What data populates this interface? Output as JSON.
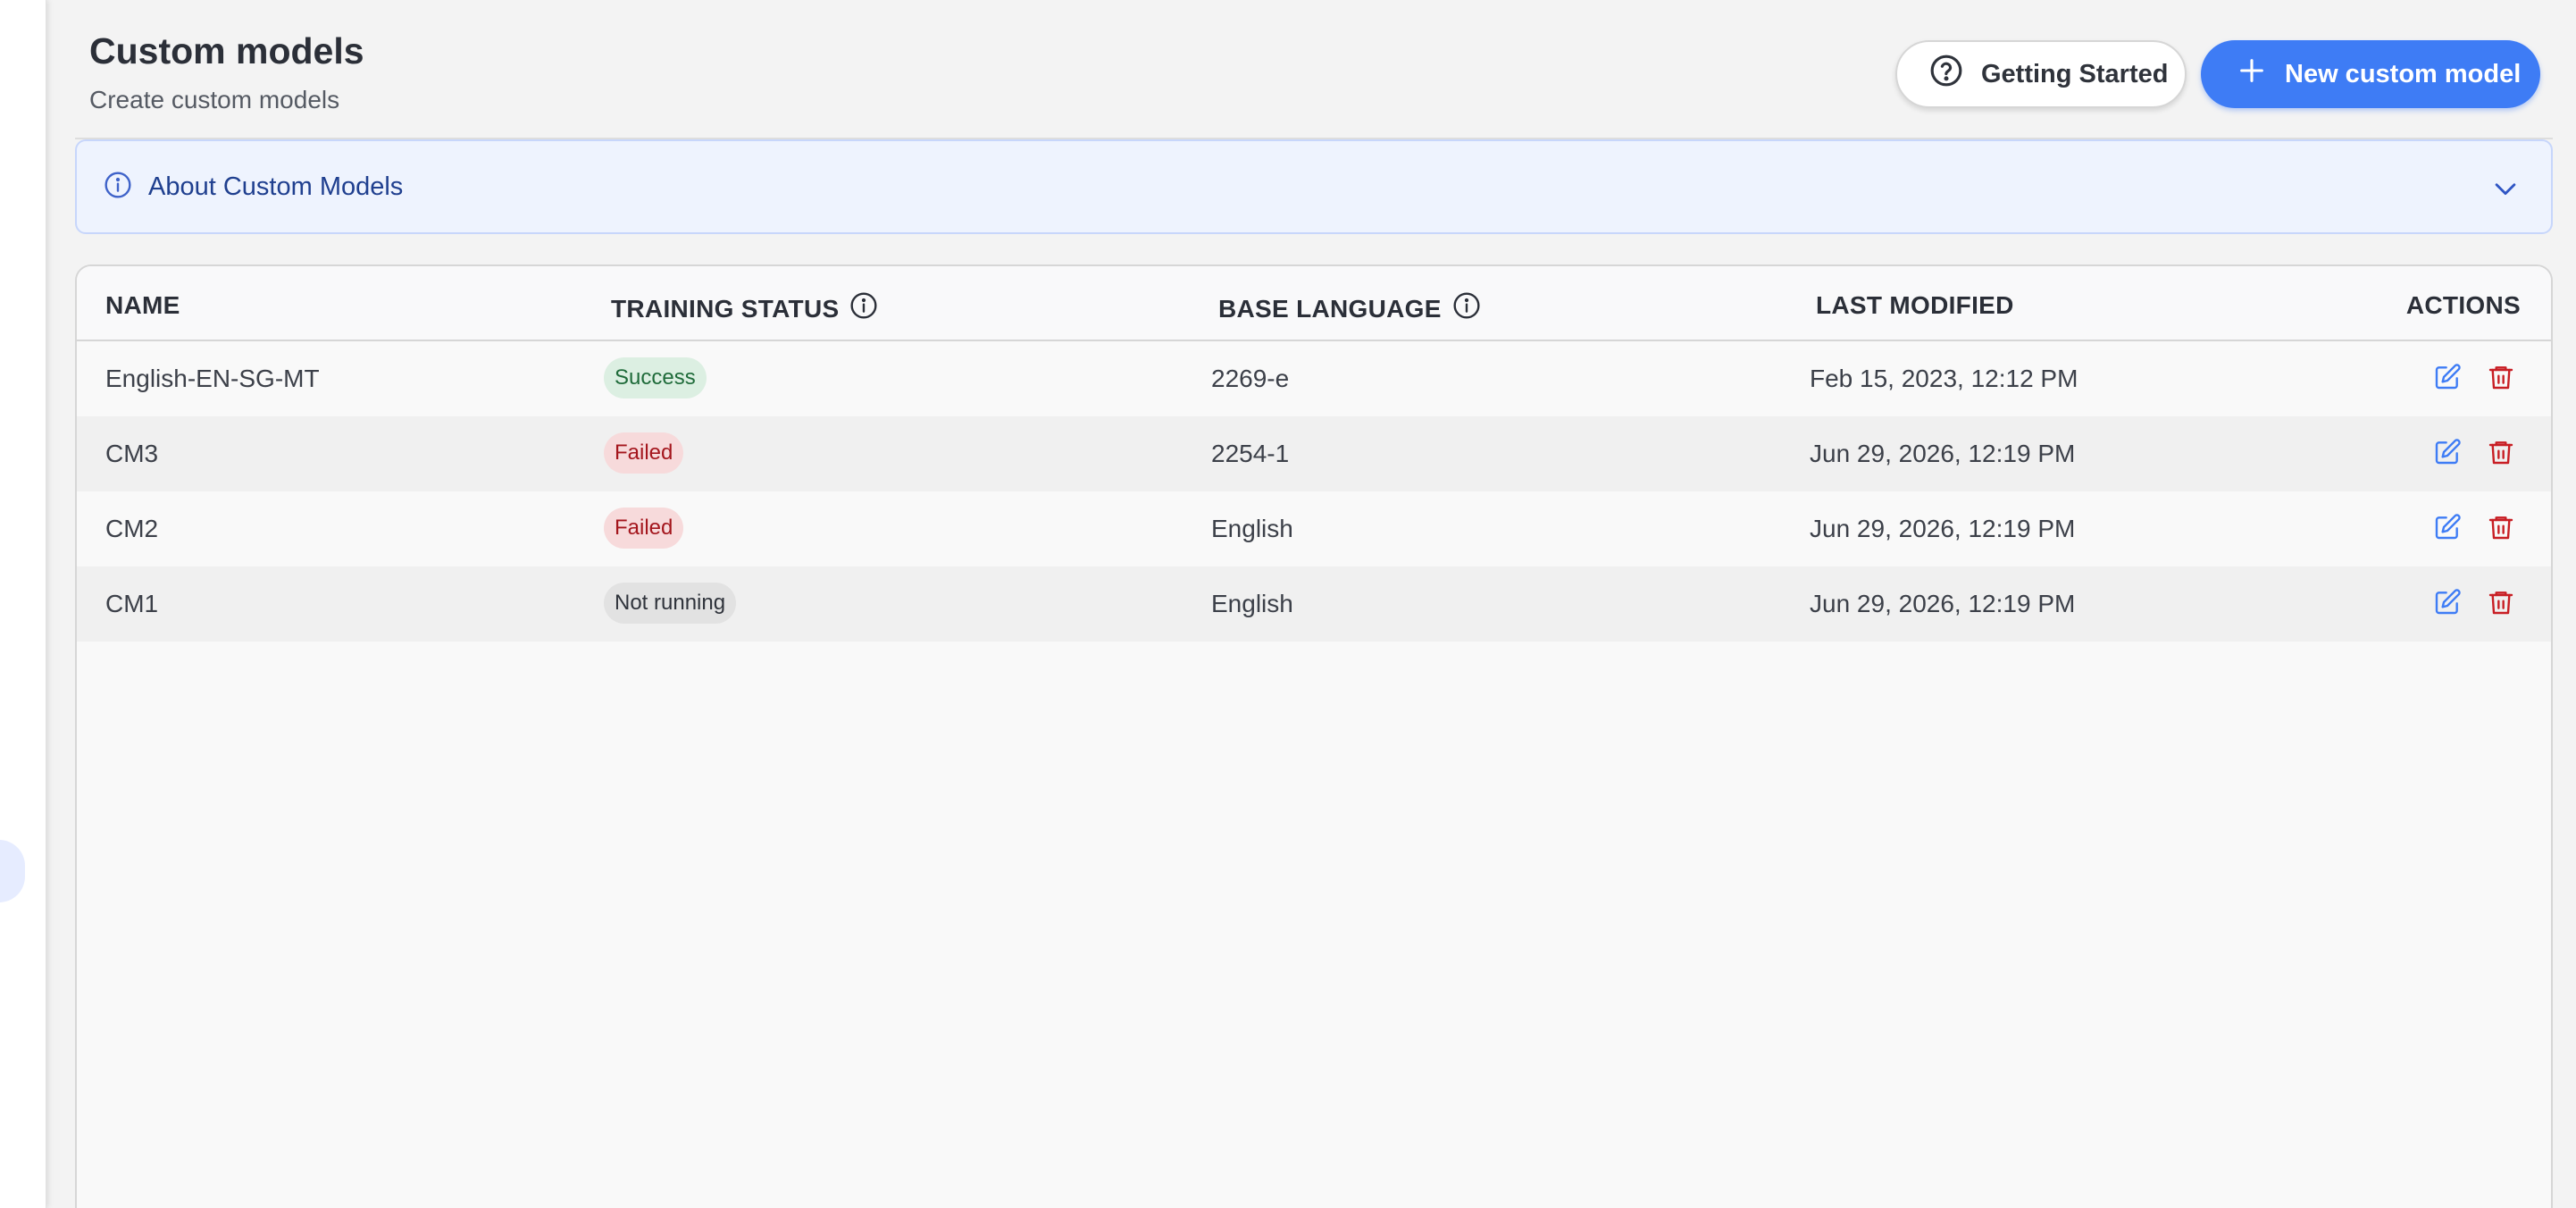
{
  "header": {
    "title": "Custom models",
    "subtitle": "Create custom models",
    "getting_started_label": "Getting Started",
    "new_model_label": "New custom model"
  },
  "banner": {
    "label": "About Custom Models"
  },
  "table": {
    "columns": {
      "name": "NAME",
      "training_status": "TRAINING STATUS",
      "base_language": "BASE LANGUAGE",
      "last_modified": "LAST MODIFIED",
      "actions": "ACTIONS"
    },
    "rows": [
      {
        "name": "English-EN-SG-MT",
        "status": "Success",
        "base_language": "2269-e",
        "last_modified": "Feb 15, 2023, 12:12 PM"
      },
      {
        "name": "CM3",
        "status": "Failed",
        "base_language": "2254-1",
        "last_modified": "Jun 29, 2026, 12:19 PM"
      },
      {
        "name": "CM2",
        "status": "Failed",
        "base_language": "English",
        "last_modified": "Jun 29, 2026, 12:19 PM"
      },
      {
        "name": "CM1",
        "status": "Not running",
        "base_language": "English",
        "last_modified": "Jun 29, 2026, 12:19 PM"
      }
    ]
  },
  "colors": {
    "accent": "#3e7cf5",
    "success_bg": "#dcefe2",
    "failed_bg": "#f7dadb",
    "idle_bg": "#e2e2e2",
    "edit_icon": "#3e7cf5",
    "delete_icon": "#c81e24"
  },
  "icons": [
    "question-circle-icon",
    "plus-icon",
    "info-icon",
    "chevron-down-icon",
    "edit-icon",
    "trash-icon"
  ]
}
